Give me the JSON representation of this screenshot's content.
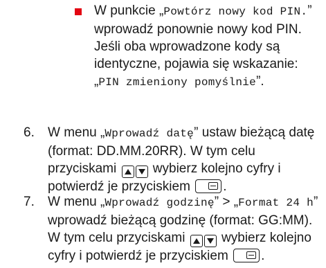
{
  "bullet": {
    "t1": "W punkcie „",
    "code1": "Powtórz nowy kod PIN.",
    "t2": "” wprowadź ponownie nowy kod PIN. Jeśli oba wprowadzone kody są identyczne, pojawia się wskazanie: „",
    "code2": "PIN zmieniony pomyślnie",
    "t3": "”."
  },
  "step6": {
    "number": "6.",
    "t1": "W menu „",
    "code1": "Wprowadź datę",
    "t2": "” ustaw bieżącą datę (format: DD.MM.20RR). W tym celu przyciskami",
    "t3": " wybierz kolejno cyfry i potwierdź je przyciskiem",
    "t4": "."
  },
  "step7": {
    "number": "7.",
    "t1": "W menu „",
    "code1": "Wprowadź godzinę",
    "t2": "” > „",
    "code2": "Format 24 h",
    "t3": "” wprowadź bieżącą godzinę (format: GG:MM). W tym celu przyciskami",
    "t4": " wybierz kolejno cyfry i potwierdź je przyciskiem",
    "t5": "."
  },
  "icons": [
    "up-down-arrow-buttons",
    "enter-button"
  ],
  "colors": {
    "bullet": "#e30613",
    "text": "#1a1a1a"
  }
}
